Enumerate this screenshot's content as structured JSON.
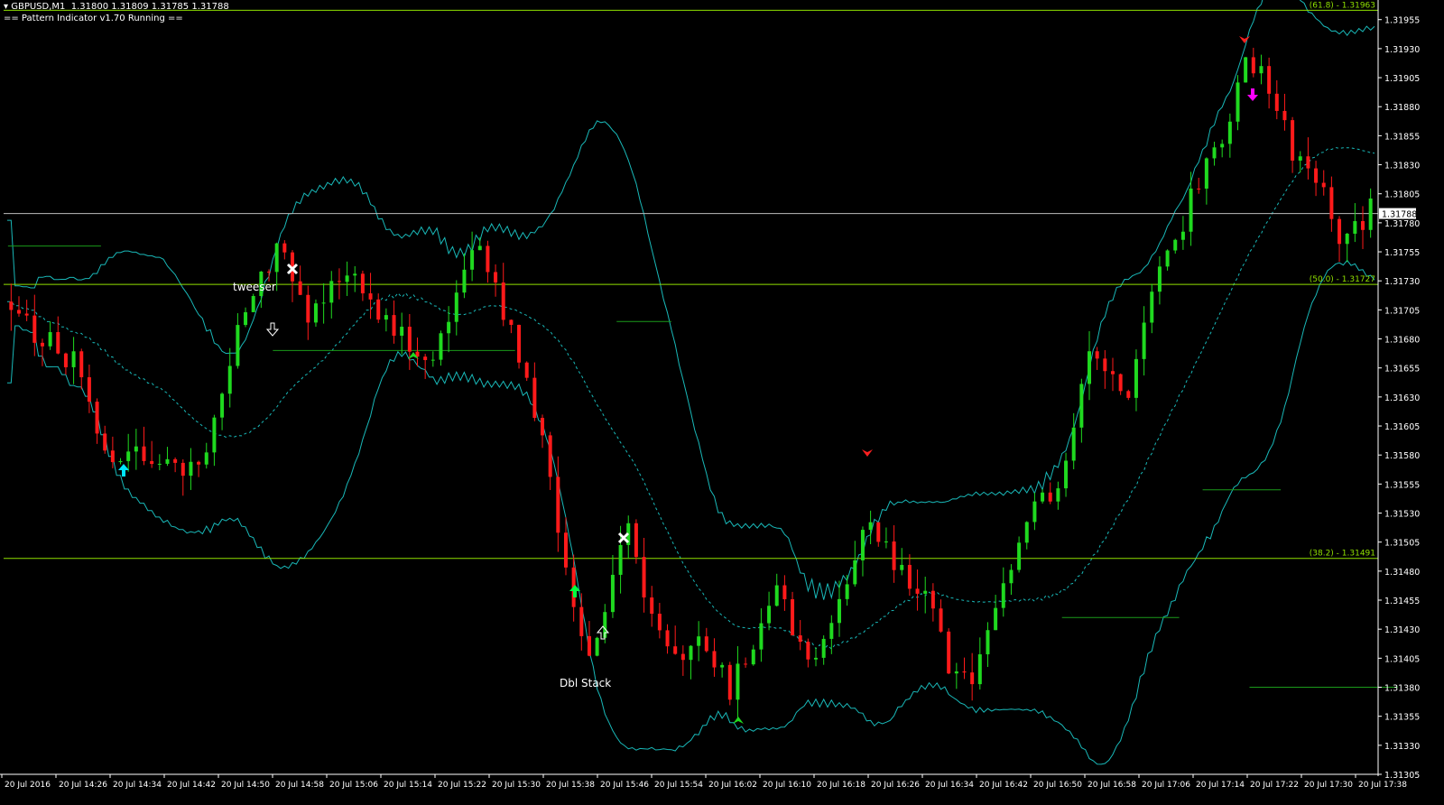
{
  "header": {
    "symbol_line": "GBPUSD,M1  1.31800 1.31809 1.31785 1.31788",
    "indicator_status": "== Pattern Indicator v1.70 Running =="
  },
  "colors": {
    "background": "#000000",
    "bull": "#1fd91f",
    "bear": "#ff1a1a",
    "band": "#19b8b8",
    "fib": "#8fe000",
    "grid_text": "#ffffff"
  },
  "price_axis": {
    "min": 1.31305,
    "max": 1.31968,
    "ticks": [
      "1.31955",
      "1.31930",
      "1.31905",
      "1.31880",
      "1.31855",
      "1.31830",
      "1.31805",
      "1.31780",
      "1.31755",
      "1.31730",
      "1.31705",
      "1.31680",
      "1.31655",
      "1.31630",
      "1.31605",
      "1.31580",
      "1.31555",
      "1.31530",
      "1.31505",
      "1.31480",
      "1.31455",
      "1.31430",
      "1.31405",
      "1.31380",
      "1.31355",
      "1.31330",
      "1.31305"
    ],
    "current_price": "1.31788",
    "current_price_value": 1.31788
  },
  "time_axis": {
    "labels": [
      "20 Jul 2016",
      "20 Jul 14:26",
      "20 Jul 14:34",
      "20 Jul 14:42",
      "20 Jul 14:50",
      "20 Jul 14:58",
      "20 Jul 15:06",
      "20 Jul 15:14",
      "20 Jul 15:22",
      "20 Jul 15:30",
      "20 Jul 15:38",
      "20 Jul 15:46",
      "20 Jul 15:54",
      "20 Jul 16:02",
      "20 Jul 16:10",
      "20 Jul 16:18",
      "20 Jul 16:26",
      "20 Jul 16:34",
      "20 Jul 16:42",
      "20 Jul 16:50",
      "20 Jul 16:58",
      "20 Jul 17:06",
      "20 Jul 17:14",
      "20 Jul 17:22",
      "20 Jul 17:30",
      "20 Jul 17:38"
    ]
  },
  "fib_levels": [
    {
      "label": "(61.8) - 1.31963",
      "value": 1.31963
    },
    {
      "label": "(50.0) - 1.31727",
      "value": 1.31727
    },
    {
      "label": "(38.2) - 1.31491",
      "value": 1.31491
    }
  ],
  "annotations": {
    "tweeser": "tweeser",
    "dbl_stack": "Dbl Stack"
  },
  "chart_data": {
    "type": "candlestick",
    "title": "GBPUSD,M1",
    "series": [
      {
        "name": "GBPUSD,M1",
        "anchors": [
          [
            0,
            1.3171
          ],
          [
            10,
            1.3168
          ],
          [
            18,
            1.3166
          ],
          [
            24,
            1.31605
          ],
          [
            30,
            1.3157
          ],
          [
            36,
            1.31585
          ],
          [
            44,
            1.31565
          ],
          [
            52,
            1.3158
          ],
          [
            60,
            1.3169
          ],
          [
            70,
            1.3176
          ],
          [
            78,
            1.317
          ],
          [
            88,
            1.3174
          ],
          [
            95,
            1.317
          ],
          [
            104,
            1.3168
          ],
          [
            110,
            1.3166
          ],
          [
            116,
            1.3172
          ],
          [
            122,
            1.3176
          ],
          [
            128,
            1.317
          ],
          [
            134,
            1.3165
          ],
          [
            140,
            1.3156
          ],
          [
            146,
            1.3144
          ],
          [
            150,
            1.314
          ],
          [
            156,
            1.3148
          ],
          [
            160,
            1.3152
          ],
          [
            166,
            1.3144
          ],
          [
            172,
            1.314
          ],
          [
            180,
            1.3142
          ],
          [
            186,
            1.3138
          ],
          [
            192,
            1.3142
          ],
          [
            198,
            1.3146
          ],
          [
            206,
            1.314
          ],
          [
            214,
            1.3146
          ],
          [
            222,
            1.3152
          ],
          [
            230,
            1.3148
          ],
          [
            236,
            1.3146
          ],
          [
            242,
            1.314
          ],
          [
            248,
            1.3138
          ],
          [
            254,
            1.3144
          ],
          [
            262,
            1.3152
          ],
          [
            270,
            1.3156
          ],
          [
            278,
            1.3166
          ],
          [
            288,
            1.3164
          ],
          [
            294,
            1.3172
          ],
          [
            300,
            1.3176
          ],
          [
            306,
            1.3182
          ],
          [
            312,
            1.3185
          ],
          [
            318,
            1.3192
          ],
          [
            324,
            1.319
          ],
          [
            330,
            1.3184
          ],
          [
            336,
            1.3182
          ],
          [
            342,
            1.3176
          ],
          [
            350,
            1.3179
          ]
        ]
      }
    ]
  }
}
